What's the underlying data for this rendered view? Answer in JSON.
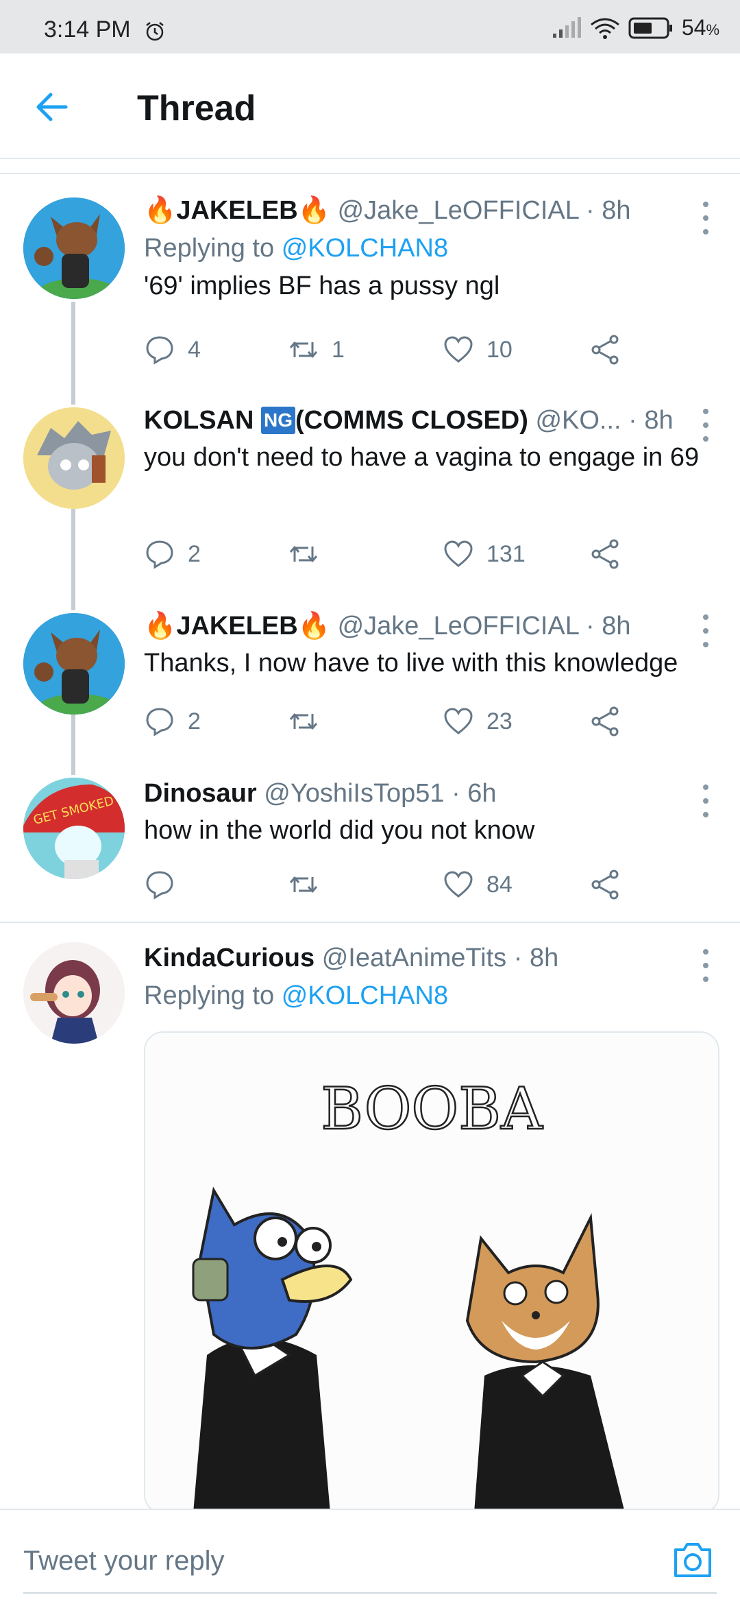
{
  "status_bar": {
    "time": "3:14 PM",
    "battery": "54",
    "battery_unit": "%"
  },
  "header": {
    "title": "Thread"
  },
  "tweets": [
    {
      "name_prefix": "🔥",
      "name": "JAKELEB",
      "name_suffix": "🔥",
      "handle": "@Jake_LeOFFICIAL",
      "time": "8h",
      "replying_label": "Replying to",
      "replying_to": "@KOLCHAN8",
      "text": "'69' implies BF has a pussy ngl",
      "replies": "4",
      "retweets": "1",
      "likes": "10"
    },
    {
      "name": "KOLSAN",
      "badge": "NG",
      "name_suffix": "(COMMS CLOSED)",
      "handle": "@KO...",
      "time": "8h",
      "text": "you don't need to have a vagina to engage in 69",
      "replies": "2",
      "retweets": "",
      "likes": "131"
    },
    {
      "name_prefix": "🔥",
      "name": "JAKELEB",
      "name_suffix": "🔥",
      "handle": "@Jake_LeOFFICIAL",
      "time": "8h",
      "text": "Thanks, I now have to live with this knowledge",
      "replies": "2",
      "retweets": "",
      "likes": "23"
    },
    {
      "name": "Dinosaur",
      "handle": "@YoshiIsTop51",
      "time": "6h",
      "text": "how in the world did you not know",
      "avatar_text": "GET SMOKED",
      "replies": "",
      "retweets": "",
      "likes": "84"
    },
    {
      "name": "KindaCurious",
      "handle": "@IeatAnimeTits",
      "time": "8h",
      "replying_label": "Replying to",
      "replying_to": "@KOLCHAN8",
      "media_text": "BOOBA"
    }
  ],
  "reply_bar": {
    "placeholder": "Tweet your reply"
  },
  "colors": {
    "accent": "#1da1f2",
    "muted": "#657786",
    "text": "#14171a"
  },
  "icons": [
    "back-arrow-icon",
    "reply-icon",
    "retweet-icon",
    "like-icon",
    "share-icon",
    "more-icon",
    "camera-icon",
    "alarm-icon",
    "signal-icon",
    "wifi-icon",
    "battery-icon"
  ]
}
